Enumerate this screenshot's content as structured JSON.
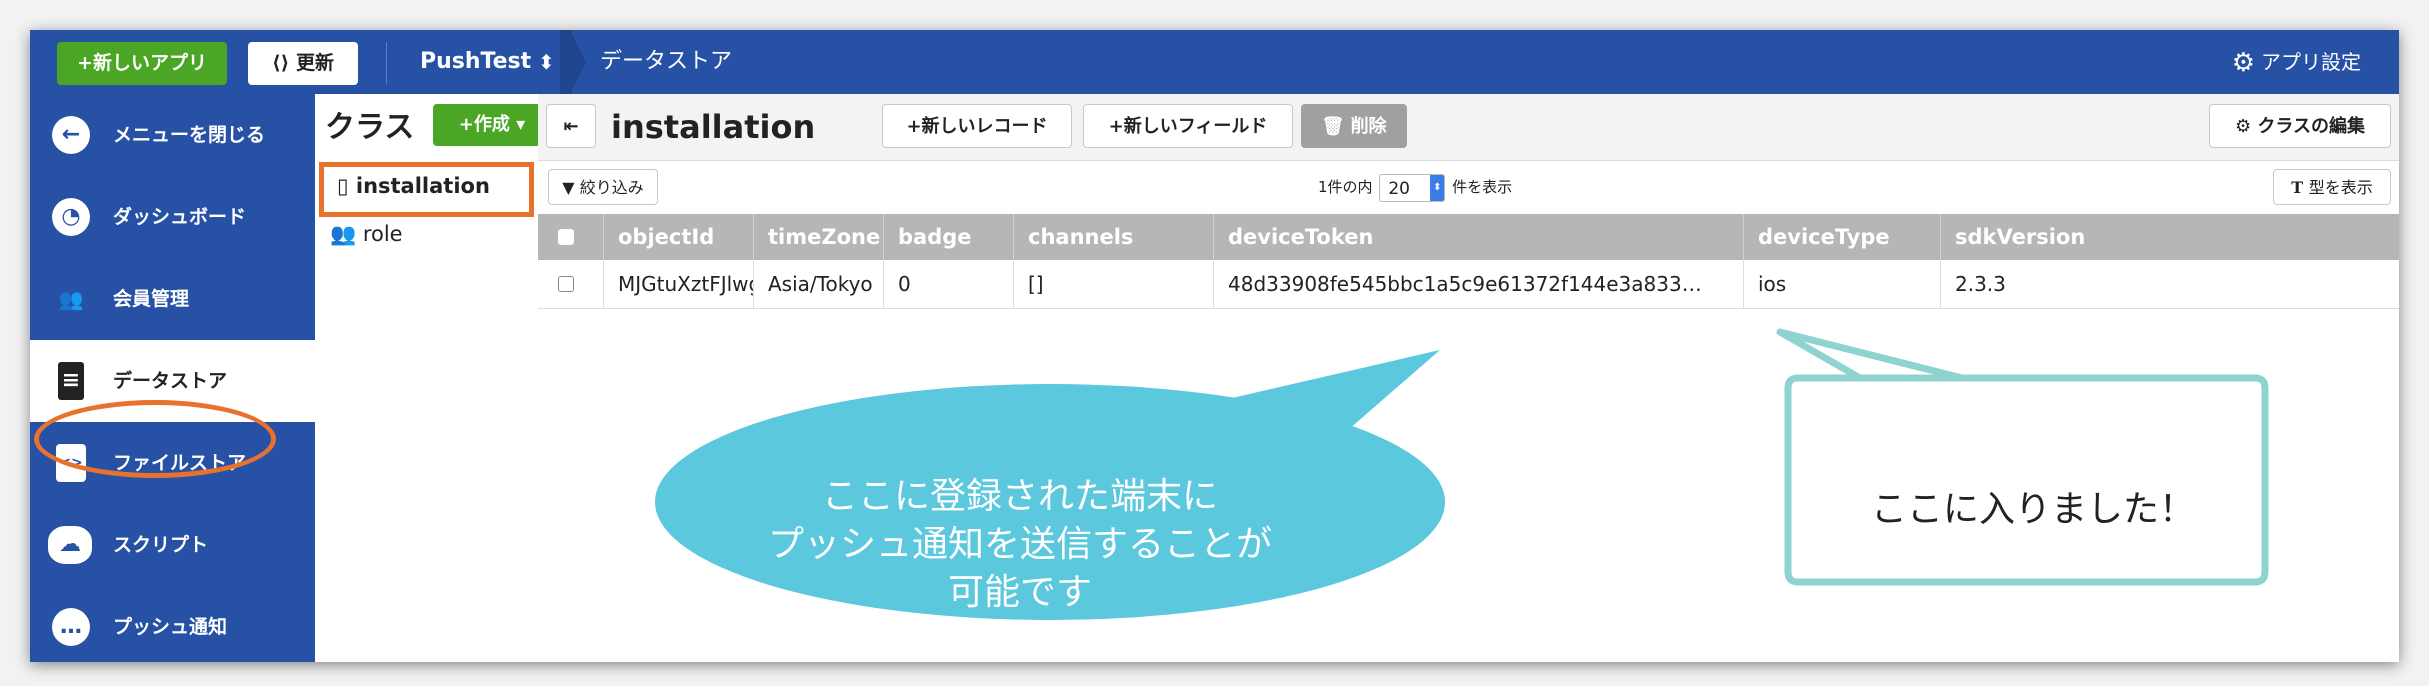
{
  "topbar": {
    "new_app_label": "+新しいアプリ",
    "refresh_label": "更新",
    "app_name": "PushTest",
    "breadcrumb": "データストア",
    "settings_label": "アプリ設定"
  },
  "sidebar": {
    "items": [
      {
        "label": "メニューを閉じる",
        "icon": "arrow-left-icon"
      },
      {
        "label": "ダッシュボード",
        "icon": "gauge-icon"
      },
      {
        "label": "会員管理",
        "icon": "users-icon"
      },
      {
        "label": "データストア",
        "icon": "database-icon",
        "active": true
      },
      {
        "label": "ファイルストア",
        "icon": "file-code-icon"
      },
      {
        "label": "スクリプト",
        "icon": "cloud-gear-icon"
      },
      {
        "label": "プッシュ通知",
        "icon": "chat-bubble-icon"
      }
    ]
  },
  "classes": {
    "title": "クラス",
    "create_label": "+作成",
    "items": [
      "installation",
      "role"
    ]
  },
  "main": {
    "title": "installation",
    "new_record_label": "+新しいレコード",
    "new_field_label": "+新しいフィールド",
    "delete_label": "削除",
    "edit_class_label": "クラスの編集",
    "filter_label": "絞り込み",
    "pager_prefix": "1件の内",
    "pager_value": "20",
    "pager_suffix": "件を表示",
    "show_type_label": "型を表示"
  },
  "table": {
    "columns": [
      "objectId",
      "timeZone",
      "badge",
      "channels",
      "deviceToken",
      "deviceType",
      "sdkVersion"
    ],
    "rows": [
      [
        "MJGtuXztFJlwgvqK",
        "Asia/Tokyo",
        "0",
        "[]",
        "48d33908fe545bbc1a5c9e61372f144e3a833…",
        "ios",
        "2.3.3"
      ]
    ]
  },
  "callouts": {
    "blue_lines": [
      "ここに登録された端末に",
      "プッシュ通知を送信することが",
      "可能です"
    ],
    "teal": "ここに入りました！"
  },
  "colors": {
    "nav_blue": "#2751a4",
    "green": "#4aa624",
    "orange": "#e8712c",
    "callout_blue": "#5bc8dd",
    "callout_teal": "#8ed3cf"
  }
}
